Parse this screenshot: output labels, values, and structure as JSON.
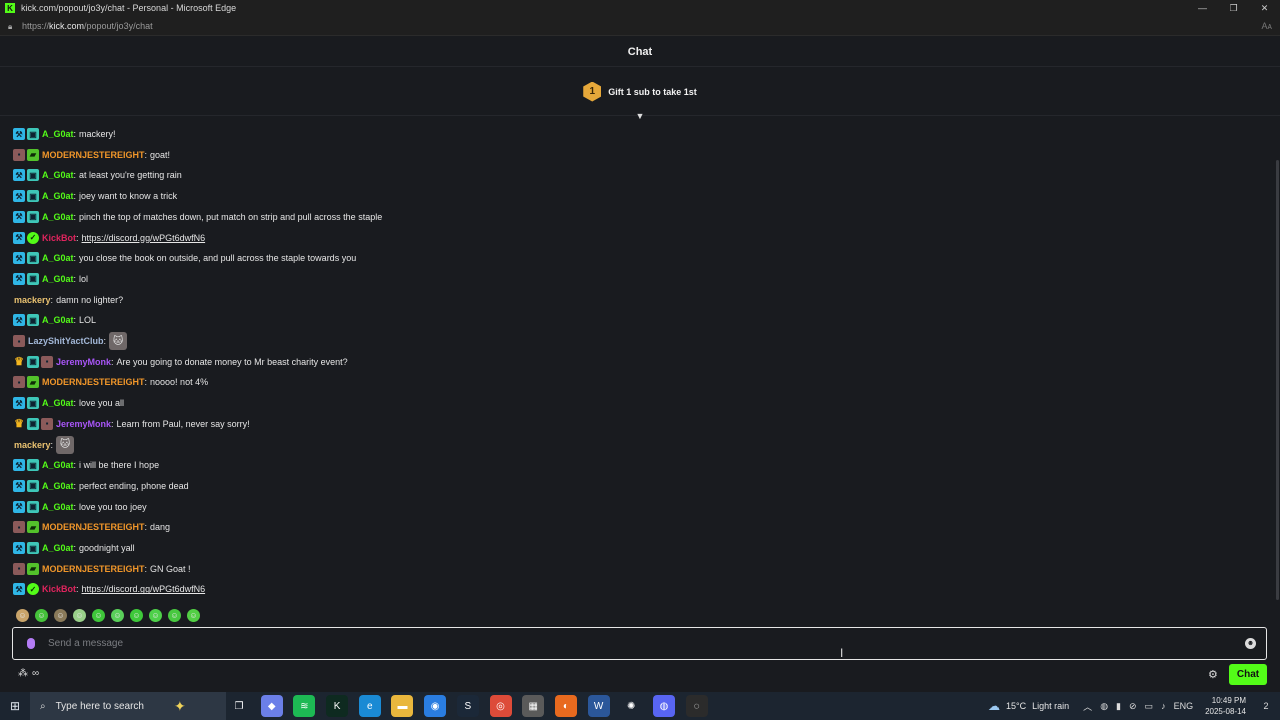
{
  "window": {
    "title": "kick.com/popout/jo3y/chat - Personal - Microsoft Edge",
    "url_prefix": "https://",
    "url_domain": "kick.com",
    "url_path": "/popout/jo3y/chat",
    "read_aloud": "Aᴀ"
  },
  "header": {
    "title": "Chat"
  },
  "gift": {
    "badge_number": "1",
    "text": "Gift 1 sub to take 1st"
  },
  "colors": {
    "mod": "#2fb6e6",
    "green_user": "#53fc18",
    "orange_user": "#f0962a",
    "kickbot": "#e0245e",
    "mackery": "#e8c170",
    "purple_user": "#a855f7",
    "lazy_user": "#a3b8d8",
    "accent": "#53fc18"
  },
  "messages": [
    {
      "badges": [
        "mod",
        "sub"
      ],
      "user": "A_G0at",
      "color": "#53fc18",
      "text": "mackery!"
    },
    {
      "badges": [
        "og",
        "green"
      ],
      "user": "MODERNJESTEREIGHT",
      "color": "#f0962a",
      "text": "goat!"
    },
    {
      "badges": [
        "mod",
        "sub"
      ],
      "user": "A_G0at",
      "color": "#53fc18",
      "text": "at least you're getting rain"
    },
    {
      "badges": [
        "mod",
        "sub"
      ],
      "user": "A_G0at",
      "color": "#53fc18",
      "text": "joey want to know a trick"
    },
    {
      "badges": [
        "mod",
        "sub"
      ],
      "user": "A_G0at",
      "color": "#53fc18",
      "text": "pinch the top of matches down, put match on strip and pull across the staple"
    },
    {
      "badges": [
        "mod",
        "verified"
      ],
      "user": "KickBot",
      "color": "#e0245e",
      "link": "https://discord.gg/wPGt6dwfN6"
    },
    {
      "badges": [
        "mod",
        "sub"
      ],
      "user": "A_G0at",
      "color": "#53fc18",
      "text": "you close the book on outside, and pull across the staple towards you"
    },
    {
      "badges": [
        "mod",
        "sub"
      ],
      "user": "A_G0at",
      "color": "#53fc18",
      "text": "lol"
    },
    {
      "badges": [],
      "user": "mackery",
      "color": "#e8c170",
      "text": "damn no lighter?"
    },
    {
      "badges": [
        "mod",
        "sub"
      ],
      "user": "A_G0at",
      "color": "#53fc18",
      "text": "LOL"
    },
    {
      "badges": [
        "og"
      ],
      "user": "LazyShitYactClub",
      "color": "#a3b8d8",
      "emote": "cat-emote"
    },
    {
      "badges": [
        "crown",
        "sub",
        "og"
      ],
      "user": "JeremyMonk",
      "color": "#a855f7",
      "text": "Are you going to donate money to Mr beast charity event?"
    },
    {
      "badges": [
        "og",
        "green"
      ],
      "user": "MODERNJESTEREIGHT",
      "color": "#f0962a",
      "text": "noooo! not 4%"
    },
    {
      "badges": [
        "mod",
        "sub"
      ],
      "user": "A_G0at",
      "color": "#53fc18",
      "text": "love you all"
    },
    {
      "badges": [
        "crown",
        "sub",
        "og"
      ],
      "user": "JeremyMonk",
      "color": "#a855f7",
      "text": "Learn from Paul, never say sorry!"
    },
    {
      "badges": [],
      "user": "mackery",
      "color": "#e8c170",
      "emote": "cat-emote"
    },
    {
      "badges": [
        "mod",
        "sub"
      ],
      "user": "A_G0at",
      "color": "#53fc18",
      "text": "i will be there I hope"
    },
    {
      "badges": [
        "mod",
        "sub"
      ],
      "user": "A_G0at",
      "color": "#53fc18",
      "text": "perfect ending, phone dead"
    },
    {
      "badges": [
        "mod",
        "sub"
      ],
      "user": "A_G0at",
      "color": "#53fc18",
      "text": "love you too joey"
    },
    {
      "badges": [
        "og",
        "green"
      ],
      "user": "MODERNJESTEREIGHT",
      "color": "#f0962a",
      "text": "dang"
    },
    {
      "badges": [
        "mod",
        "sub"
      ],
      "user": "A_G0at",
      "color": "#53fc18",
      "text": "goodnight yall"
    },
    {
      "badges": [
        "og",
        "green"
      ],
      "user": "MODERNJESTEREIGHT",
      "color": "#f0962a",
      "text": "GN Goat !"
    },
    {
      "badges": [
        "mod",
        "verified"
      ],
      "user": "KickBot",
      "color": "#e0245e",
      "link": "https://discord.gg/wPGt6dwfN6"
    }
  ],
  "quick_emotes": [
    {
      "name": "emote-1",
      "color": "#c9a46a"
    },
    {
      "name": "emote-2",
      "color": "#45c23a"
    },
    {
      "name": "emote-3",
      "color": "#8a7a5a"
    },
    {
      "name": "emote-4",
      "color": "#9ad08a"
    },
    {
      "name": "emote-5",
      "color": "#3fc63a"
    },
    {
      "name": "emote-6",
      "color": "#5ad05a"
    },
    {
      "name": "emote-7",
      "color": "#3ec83a"
    },
    {
      "name": "emote-8",
      "color": "#4ed04a"
    },
    {
      "name": "emote-9",
      "color": "#48c840"
    },
    {
      "name": "emote-10",
      "color": "#52cf44"
    }
  ],
  "input": {
    "placeholder": "Send a message"
  },
  "controls": {
    "chat_button": "Chat"
  },
  "taskbar": {
    "search_placeholder": "Type here to search",
    "weather_temp": "15°C",
    "weather_text": "Light rain",
    "language": "ENG",
    "time": "10:49 PM",
    "date": "2025-08-14",
    "notifications": "2",
    "apps": [
      {
        "name": "task-view-icon",
        "color": "transparent",
        "glyph": "❐"
      },
      {
        "name": "copilot-icon",
        "color": "#6b7fe8",
        "glyph": "◆"
      },
      {
        "name": "spotify-icon",
        "color": "#1db954",
        "glyph": "≋"
      },
      {
        "name": "kick-app-icon",
        "color": "#0e2a20",
        "glyph": "K"
      },
      {
        "name": "edge-icon",
        "color": "#1a8ad4",
        "glyph": "e"
      },
      {
        "name": "file-explorer-icon",
        "color": "#e9b73d",
        "glyph": "▬"
      },
      {
        "name": "app-blue-icon",
        "color": "#2a7de1",
        "glyph": "◉"
      },
      {
        "name": "steam-icon",
        "color": "#1b2838",
        "glyph": "S"
      },
      {
        "name": "chrome-icon",
        "color": "#dd4b39",
        "glyph": "◎"
      },
      {
        "name": "calculator-icon",
        "color": "#5a5a5a",
        "glyph": "▦"
      },
      {
        "name": "firefox-icon",
        "color": "#e86a1f",
        "glyph": "◐"
      },
      {
        "name": "word-icon",
        "color": "#2b579a",
        "glyph": "W"
      },
      {
        "name": "chatgpt-icon",
        "color": "transparent",
        "glyph": "✺"
      },
      {
        "name": "discord-icon",
        "color": "#5865f2",
        "glyph": "◍"
      },
      {
        "name": "obs-icon",
        "color": "#2b2b2b",
        "glyph": "◌"
      }
    ]
  }
}
